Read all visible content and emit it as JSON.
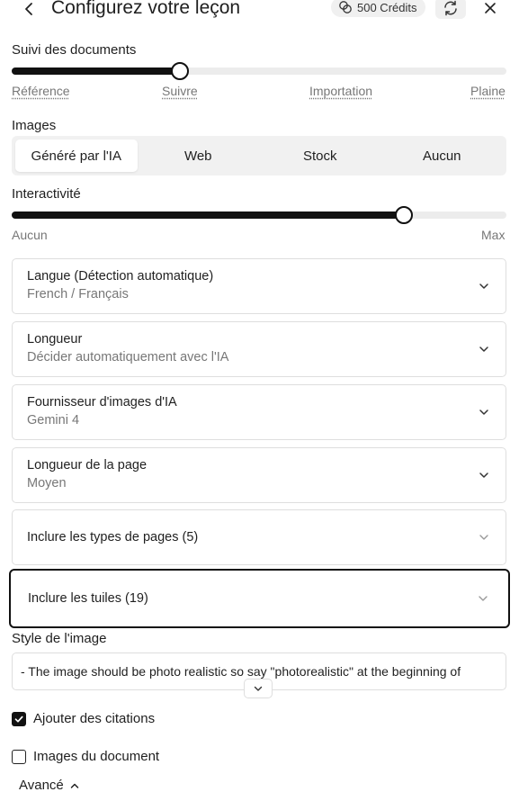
{
  "header": {
    "title": "Configurez votre leçon",
    "credits": "500 Crédits"
  },
  "documents": {
    "label": "Suivi des documents",
    "value_fraction": 0.34,
    "stops": [
      "Référence",
      "Suivre",
      "Importation",
      "Plaine"
    ]
  },
  "images": {
    "label": "Images",
    "options": [
      "Généré par l'IA",
      "Web",
      "Stock",
      "Aucun"
    ],
    "selected": "Généré par l'IA"
  },
  "interactivity": {
    "label": "Interactivité",
    "value_fraction": 0.792,
    "min_label": "Aucun",
    "max_label": "Max"
  },
  "selects": [
    {
      "label": "Langue (Détection automatique)",
      "value": "French / Français"
    },
    {
      "label": "Longueur",
      "value": "Décider automatiquement avec l'IA"
    },
    {
      "label": "Fournisseur d'images d'IA",
      "value": "Gemini 4"
    },
    {
      "label": "Longueur de la page",
      "value": "Moyen"
    }
  ],
  "page_types": {
    "label": "Inclure les types de pages (5)"
  },
  "tiles": {
    "label": "Inclure les tuiles (19)"
  },
  "image_style": {
    "label": "Style de l'image",
    "value": "- The image should be photo realistic so say \"photorealistic\" at the beginning of"
  },
  "checkboxes": {
    "citations": {
      "label": "Ajouter des citations",
      "checked": true
    },
    "doc_images": {
      "label": "Images du document",
      "checked": false
    }
  },
  "advanced": {
    "label": "Avancé"
  }
}
